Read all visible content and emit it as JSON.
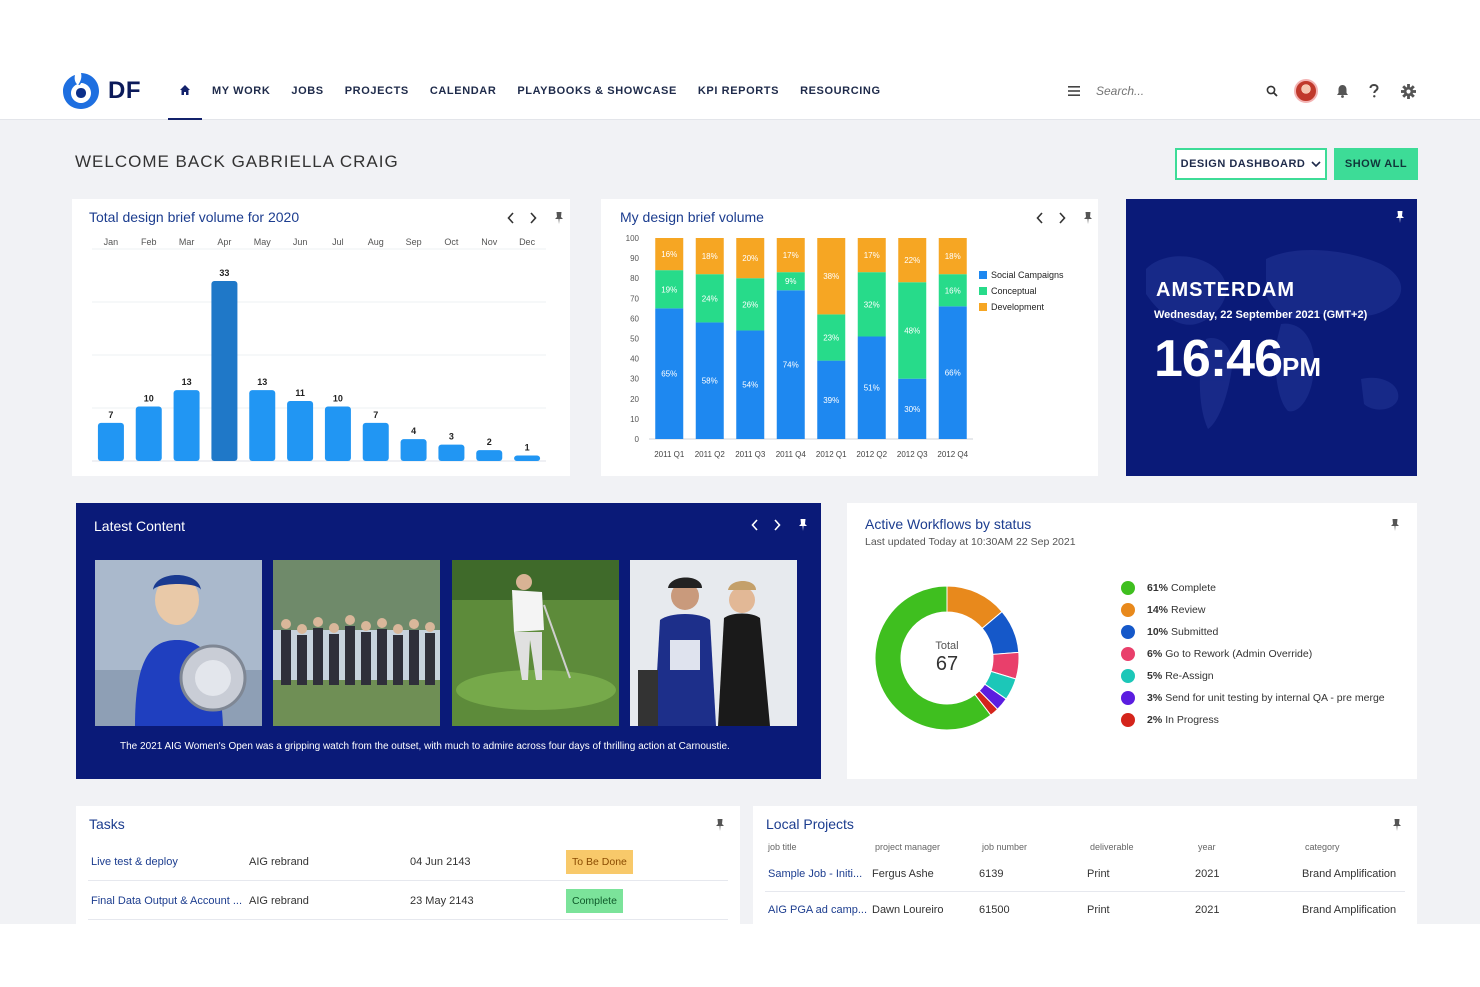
{
  "app": {
    "logo_text": "DF",
    "nav": [
      "MY WORK",
      "JOBS",
      "PROJECTS",
      "CALENDAR",
      "PLAYBOOKS & SHOWCASE",
      "KPI REPORTS",
      "RESOURCING"
    ],
    "search_placeholder": "Search..."
  },
  "page": {
    "welcome": "WELCOME BACK GABRIELLA CRAIG",
    "design_dashboard_label": "DESIGN DASHBOARD",
    "show_all_label": "SHOW ALL"
  },
  "brief_card": {
    "title": "Total design brief volume for 2020",
    "chart_data": {
      "type": "bar",
      "categories": [
        "Jan",
        "Feb",
        "Mar",
        "Apr",
        "May",
        "Jun",
        "Jul",
        "Aug",
        "Sep",
        "Oct",
        "Nov",
        "Dec"
      ],
      "values": [
        7,
        10,
        13,
        33,
        13,
        11,
        10,
        7,
        4,
        3,
        2,
        1
      ],
      "highlight_index": 3,
      "ylim": [
        0,
        40
      ],
      "colors": {
        "bar": "#2196f3",
        "highlight": "#1f78c8"
      }
    }
  },
  "my_card": {
    "title": "My design brief volume",
    "chart_data": {
      "type": "bar",
      "stacked": true,
      "categories": [
        "2011 Q1",
        "2011 Q2",
        "2011 Q3",
        "2011 Q4",
        "2012 Q1",
        "2012 Q2",
        "2012 Q3",
        "2012 Q4"
      ],
      "yticks": [
        0,
        10,
        20,
        30,
        40,
        50,
        60,
        70,
        80,
        90,
        100
      ],
      "ylim": [
        0,
        100
      ],
      "legend_position": "right",
      "series": [
        {
          "name": "Social Campaigns",
          "color": "#1e88f0",
          "values": [
            65,
            58,
            54,
            74,
            39,
            51,
            30,
            66
          ]
        },
        {
          "name": "Conceptual",
          "color": "#27db8a",
          "values": [
            19,
            24,
            26,
            9,
            23,
            32,
            48,
            16
          ]
        },
        {
          "name": "Development",
          "color": "#f6a623",
          "values": [
            16,
            18,
            20,
            17,
            38,
            17,
            22,
            18
          ]
        }
      ]
    }
  },
  "clock": {
    "city": "AMSTERDAM",
    "date": "Wednesday, 22 September 2021 (GMT+2)",
    "time": "16:46",
    "ampm": "PM"
  },
  "latest": {
    "title": "Latest Content",
    "caption": "The 2021 AIG Women's Open was a gripping watch from the outset, with much to admire across four days of thrilling action at Carnoustie."
  },
  "workflows": {
    "title": "Active Workflows by status",
    "subtitle": "Last updated Today at 10:30AM 22 Sep 2021",
    "total_label": "Total",
    "total_value": "67",
    "chart_data": {
      "type": "pie",
      "donut": true,
      "slices": [
        {
          "pct": "61%",
          "label": "Complete",
          "value": 61,
          "color": "#3fbf1f"
        },
        {
          "pct": "14%",
          "label": "Review",
          "value": 14,
          "color": "#e8891c"
        },
        {
          "pct": "10%",
          "label": "Submitted",
          "value": 10,
          "color": "#1558c9"
        },
        {
          "pct": "6%",
          "label": "Go to Rework (Admin Override)",
          "value": 6,
          "color": "#e93f6b"
        },
        {
          "pct": "5%",
          "label": "Re-Assign",
          "value": 5,
          "color": "#1cc7b8"
        },
        {
          "pct": "3%",
          "label": "Send for unit testing by internal QA - pre merge",
          "value": 3,
          "color": "#5b1de0"
        },
        {
          "pct": "2%",
          "label": "In Progress",
          "value": 2,
          "color": "#d4241b"
        }
      ]
    }
  },
  "tasks": {
    "title": "Tasks",
    "rows": [
      {
        "name": "Live test & deploy",
        "project": "AIG rebrand",
        "date": "04 Jun 2143",
        "status": "To Be Done",
        "status_bg": "#f8c96a",
        "status_fg": "#8a4b00"
      },
      {
        "name": "Final Data Output & Account ...",
        "project": "AIG rebrand",
        "date": "23 May 2143",
        "status": "Complete",
        "status_bg": "#7be39a",
        "status_fg": "#0f5a2a"
      }
    ]
  },
  "local": {
    "title": "Local Projects",
    "headers": [
      "job title",
      "project manager",
      "job number",
      "deliverable",
      "year",
      "category"
    ],
    "rows": [
      [
        "Sample Job - Initi...",
        "Fergus Ashe",
        "6139",
        "Print",
        "2021",
        "Brand Amplification"
      ],
      [
        "AIG PGA ad camp...",
        "Dawn Loureiro",
        "61500",
        "Print",
        "2021",
        "Brand Amplification"
      ]
    ]
  }
}
